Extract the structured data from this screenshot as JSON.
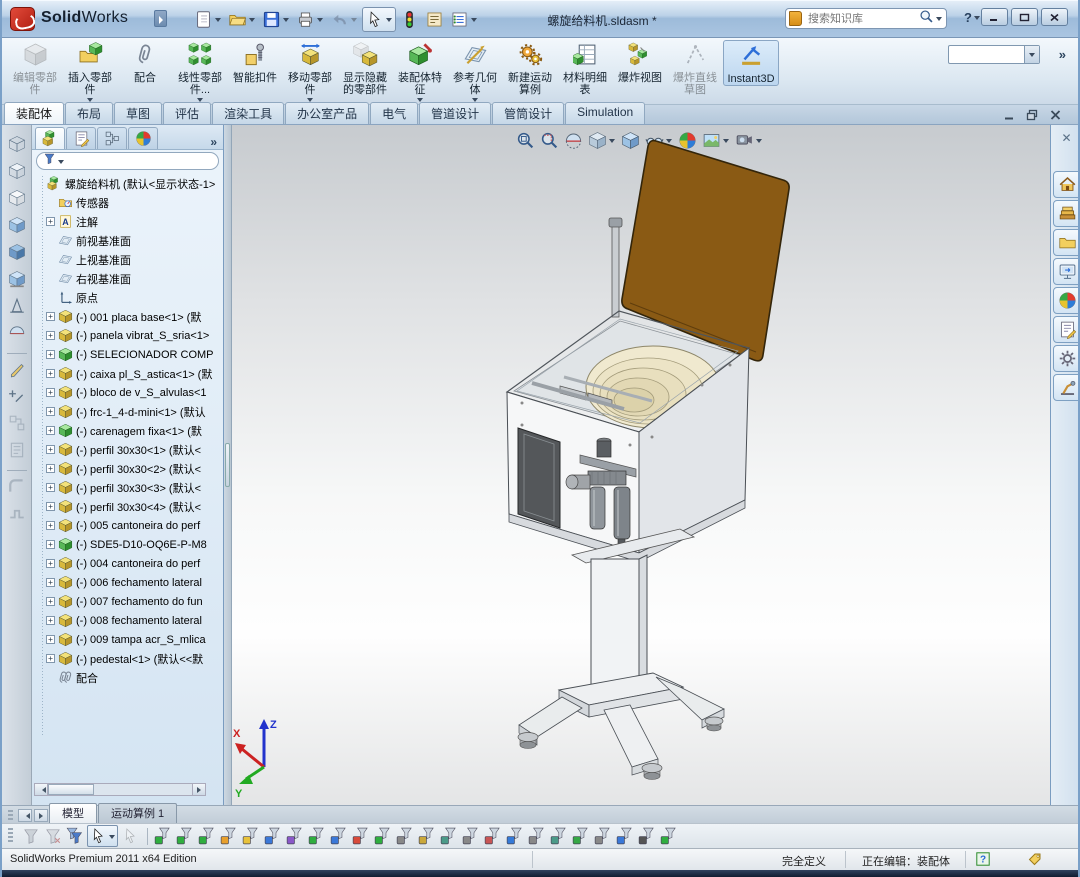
{
  "glyphs": {
    "plus": "+",
    "help": "?",
    "chevron": "»"
  },
  "window": {
    "brand_bold": "Solid",
    "brand_light": "Works",
    "title": "螺旋给料机.sldasm *",
    "search_placeholder": "搜索知识库"
  },
  "titlebar_tools": [
    {
      "name": "new-document",
      "dropdown": true
    },
    {
      "name": "open",
      "dropdown": true
    },
    {
      "name": "save",
      "dropdown": true
    },
    {
      "name": "print",
      "dropdown": true
    },
    {
      "name": "undo",
      "dropdown": true,
      "disabled": true
    },
    {
      "name": "select",
      "dropdown": true,
      "boxed": true
    },
    {
      "name": "performance",
      "dropdown": false
    },
    {
      "name": "file-properties",
      "dropdown": false
    },
    {
      "name": "options-list",
      "dropdown": true
    }
  ],
  "ribbon": {
    "buttons": [
      {
        "name": "edit-component",
        "label": "编辑零部件",
        "disabled": true
      },
      {
        "name": "insert-component",
        "label": "插入零部件",
        "dropdown": true
      },
      {
        "name": "mate",
        "label": "配合"
      },
      {
        "name": "linear-pattern",
        "label": "线性零部件...",
        "dropdown": true
      },
      {
        "name": "smart-fasteners",
        "label": "智能扣件"
      },
      {
        "name": "move-component",
        "label": "移动零部件",
        "dropdown": true
      },
      {
        "name": "show-hidden",
        "label": "显示隐藏的零部件"
      },
      {
        "name": "assembly-features",
        "label": "装配体特征",
        "dropdown": true
      },
      {
        "name": "reference-geometry",
        "label": "参考几何体",
        "dropdown": true
      },
      {
        "name": "motion-study",
        "label": "新建运动算例"
      },
      {
        "name": "bom",
        "label": "材料明细表"
      },
      {
        "name": "exploded-view",
        "label": "爆炸视图"
      },
      {
        "name": "explode-lines",
        "label": "爆炸直线草图",
        "disabled": true
      },
      {
        "name": "instant3d",
        "label": "Instant3D",
        "active": true
      }
    ]
  },
  "command_tabs": [
    {
      "label": "装配体",
      "active": true
    },
    {
      "label": "布局"
    },
    {
      "label": "草图"
    },
    {
      "label": "评估"
    },
    {
      "label": "渲染工具"
    },
    {
      "label": "办公室产品"
    },
    {
      "label": "电气"
    },
    {
      "label": "管道设计"
    },
    {
      "label": "管筒设计"
    },
    {
      "label": "Simulation"
    }
  ],
  "feature_manager": {
    "tabs": [
      "fm-feature",
      "fm-property",
      "fm-config",
      "fm-appearance"
    ],
    "root": {
      "icon": "assembly",
      "label": "螺旋给料机 (默认<显示状态-1>"
    },
    "items": [
      {
        "icon": "sensors-folder",
        "label": "传感器"
      },
      {
        "icon": "annotations-folder",
        "label": "注解",
        "expand": true
      },
      {
        "icon": "plane",
        "label": "前视基准面"
      },
      {
        "icon": "plane",
        "label": "上视基准面"
      },
      {
        "icon": "plane",
        "label": "右视基准面"
      },
      {
        "icon": "origin",
        "label": "原点"
      },
      {
        "icon": "part-yellow",
        "label": "(-) 001 placa base<1> (默",
        "expand": true
      },
      {
        "icon": "part-yellow",
        "label": "(-) panela vibrat_S_sria<1>",
        "expand": true
      },
      {
        "icon": "part-green",
        "label": "(-) SELECIONADOR COMP",
        "expand": true
      },
      {
        "icon": "part-yellow",
        "label": "(-) caixa pl_S_astica<1> (默",
        "expand": true
      },
      {
        "icon": "part-yellow",
        "label": "(-) bloco de v_S_alvulas<1",
        "expand": true
      },
      {
        "icon": "part-yellow",
        "label": "(-) frc-1_4-d-mini<1> (默认",
        "expand": true
      },
      {
        "icon": "part-green",
        "label": "(-) carenagem fixa<1> (默",
        "expand": true
      },
      {
        "icon": "part-yellow",
        "label": "(-) perfil 30x30<1> (默认<",
        "expand": true
      },
      {
        "icon": "part-yellow",
        "label": "(-) perfil 30x30<2> (默认<",
        "expand": true
      },
      {
        "icon": "part-yellow",
        "label": "(-) perfil 30x30<3> (默认<",
        "expand": true
      },
      {
        "icon": "part-yellow",
        "label": "(-) perfil 30x30<4> (默认<",
        "expand": true
      },
      {
        "icon": "part-yellow",
        "label": "(-) 005 cantoneira do perf",
        "expand": true
      },
      {
        "icon": "part-green",
        "label": "(-) SDE5-D10-OQ6E-P-M8",
        "expand": true
      },
      {
        "icon": "part-yellow",
        "label": "(-) 004 cantoneira do perf",
        "expand": true
      },
      {
        "icon": "part-yellow",
        "label": "(-) 006 fechamento lateral",
        "expand": true
      },
      {
        "icon": "part-yellow",
        "label": "(-) 007 fechamento do fun",
        "expand": true
      },
      {
        "icon": "part-yellow",
        "label": "(-) 008 fechamento lateral",
        "expand": true
      },
      {
        "icon": "part-yellow",
        "label": "(-) 009 tampa acr_S_mlica",
        "expand": true
      },
      {
        "icon": "part-yellow",
        "label": "(-) pedestal<1> (默认<<默",
        "expand": true
      },
      {
        "icon": "mates",
        "label": "配合"
      }
    ]
  },
  "left_toolbar": [
    "wireframe",
    "hidden-lines-visible",
    "hidden-lines-removed",
    "shaded-with-edges",
    "shaded",
    "shadows-in-shaded-mode",
    "perspective",
    "section-view",
    "sketch",
    "smart-dimension",
    "display-states",
    "appearance-callouts",
    "routing-segment",
    "weldment-member"
  ],
  "hud_toolbar": [
    {
      "name": "zoom-fit"
    },
    {
      "name": "zoom-area"
    },
    {
      "name": "section-view"
    },
    {
      "name": "view-orientation",
      "dropdown": true
    },
    {
      "name": "display-style"
    },
    {
      "name": "hide-show-items",
      "dropdown": true
    },
    {
      "name": "edit-appearance"
    },
    {
      "name": "apply-scene",
      "dropdown": true
    },
    {
      "name": "view-settings",
      "dropdown": true
    }
  ],
  "task_pane": [
    "solidworks-resources",
    "design-library",
    "file-explorer",
    "view-palette",
    "appearances-scenes",
    "custom-properties",
    "pdm-vault",
    "toolbox-library"
  ],
  "viewport": {
    "triad": {
      "x": "X",
      "y": "Y",
      "z": "Z"
    }
  },
  "model_tabs": [
    {
      "label": "模型",
      "active": true
    },
    {
      "label": "运动算例 1",
      "active": false
    }
  ],
  "filter_toolbar": {
    "leading": [
      {
        "name": "toggle-selection-filters",
        "disabled": true
      },
      {
        "name": "clear-all-filters",
        "disabled": true
      },
      {
        "name": "select-all-filters"
      },
      {
        "name": "select-tool",
        "boxed": true,
        "dropdown": true
      },
      {
        "name": "select-other",
        "disabled": true
      }
    ],
    "filters": [
      {
        "name": "filter-vertices",
        "color": "#2fae3f"
      },
      {
        "name": "filter-edges",
        "color": "#2fae3f"
      },
      {
        "name": "filter-faces",
        "color": "#2fae3f"
      },
      {
        "name": "filter-surface-bodies",
        "color": "#e8a02c"
      },
      {
        "name": "filter-solid-bodies",
        "color": "#e8c23a"
      },
      {
        "name": "filter-axes",
        "color": "#3a78d8"
      },
      {
        "name": "filter-planes",
        "color": "#8a58c8"
      },
      {
        "name": "filter-origins",
        "color": "#2fae3f"
      },
      {
        "name": "filter-coordinate-systems",
        "color": "#3a78d8"
      },
      {
        "name": "filter-sketch-points",
        "color": "#d84a3a"
      },
      {
        "name": "filter-sketch-segments",
        "color": "#2fae3f"
      },
      {
        "name": "filter-midpoints",
        "color": "#888888"
      },
      {
        "name": "filter-dimensions",
        "color": "#caa83a"
      },
      {
        "name": "filter-annotations",
        "color": "#4a9a88"
      },
      {
        "name": "filter-notes",
        "color": "#888888"
      },
      {
        "name": "filter-balloons",
        "color": "#c85555"
      },
      {
        "name": "filter-datums",
        "color": "#357ad8"
      },
      {
        "name": "filter-weld-symbols",
        "color": "#888888"
      },
      {
        "name": "filter-geometric-tolerances",
        "color": "#4a9a88"
      },
      {
        "name": "filter-cosmetic-threads",
        "color": "#35a845"
      },
      {
        "name": "filter-blocks",
        "color": "#888888"
      },
      {
        "name": "filter-connection-points",
        "color": "#3a78d8"
      },
      {
        "name": "filter-routing-points",
        "color": "#555555"
      },
      {
        "name": "filter-mate-references",
        "color": "#2fae3f"
      }
    ]
  },
  "status_bar": {
    "product": "SolidWorks Premium 2011 x64 Edition",
    "state": "完全定义",
    "editing": "正在编辑：装配体"
  },
  "colors": {
    "lid": "#8a5a14",
    "bowl": "#f0e9cf",
    "titlebar": "#a9c4e0",
    "panel": "#dcebf7",
    "accent": "#2e6fd8"
  }
}
